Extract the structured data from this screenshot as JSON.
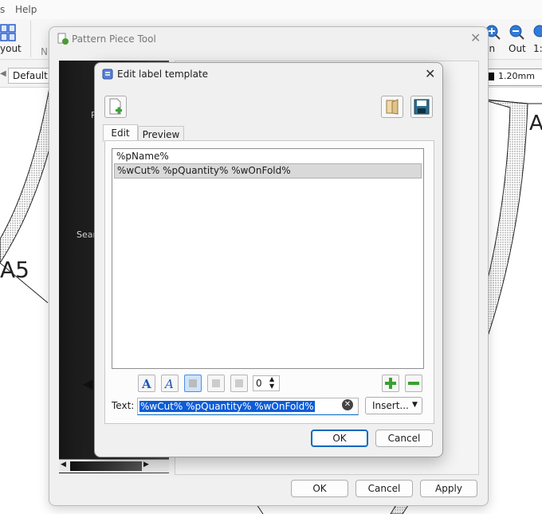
{
  "app": {
    "menu": {
      "partial_label": "s",
      "help_label": "Help"
    },
    "toolbar": {
      "layout_label": "yout",
      "zoom_in_label": "In",
      "zoom_out_label": "Out",
      "zoom_fit_label": "1:",
      "n_label": "N"
    },
    "line_default_label": "Default",
    "width_value": "1.20mm",
    "canvas": {
      "label_a5": "A5",
      "label_a": "A"
    }
  },
  "pattern_piece_tool": {
    "title": "Pattern Piece Tool",
    "left_labels": {
      "p": "P",
      "sear": "Sear"
    },
    "buttons": {
      "ok": "OK",
      "cancel": "Cancel",
      "apply": "Apply"
    }
  },
  "dialog": {
    "title": "Edit label template",
    "tabs": [
      {
        "label": "Edit"
      },
      {
        "label": "Preview"
      }
    ],
    "lines": [
      {
        "text": "%pName%"
      },
      {
        "text": "%wCut% %pQuantity% %wOnFold%"
      }
    ],
    "font_size_value": "0",
    "text_label": "Text:",
    "text_value": "%wCut% %pQuantity% %wOnFold%",
    "insert_label": "Insert...",
    "ok_label": "OK",
    "cancel_label": "Cancel"
  }
}
